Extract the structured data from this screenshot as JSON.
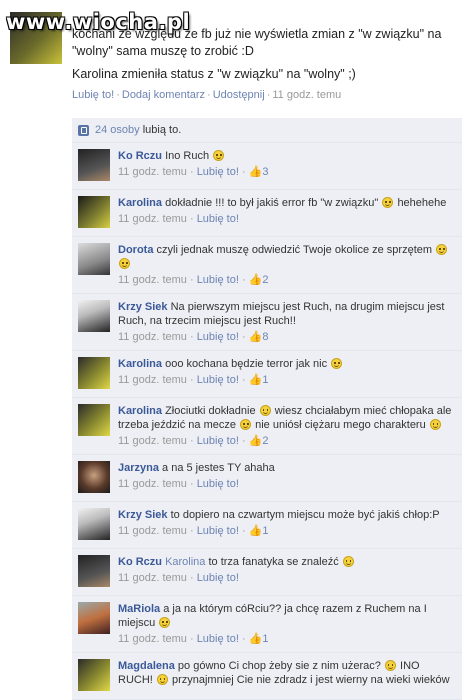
{
  "watermark": "www.wiocha.pl",
  "post": {
    "text_lines": [
      "kochani ze względu że fb już nie wyświetla zmian z \"w związku\" na",
      "\"wolny\" sama muszę to zrobić :D",
      "Karolina zmieniła status z \"w związku\" na \"wolny\" ;)"
    ],
    "actions": {
      "like": "Lubię to!",
      "comment": "Dodaj komentarz",
      "share": "Udostępnij",
      "time": "11 godz. temu"
    }
  },
  "likes_summary": {
    "count_link": "24 osoby",
    "text": "lubią to."
  },
  "comments": [
    {
      "author": "Ko Rczu",
      "text": "Ino Ruch",
      "time": "11 godz. temu",
      "like": "Lubię to!",
      "likes": "3"
    },
    {
      "author": "Karolina",
      "text": "dokładnie !!! to był jakiś error fb \"w związku\"",
      "text2": "hehehehe",
      "time": "11 godz. temu",
      "like": "Lubię to!",
      "likes": ""
    },
    {
      "author": "Dorota",
      "text": "czyli jednak muszę odwiedzić Twoje okolice ze sprzętem",
      "time": "11 godz. temu",
      "like": "Lubię to!",
      "likes": "2"
    },
    {
      "author": "Krzy Siek",
      "text": "Na pierwszym miejscu jest Ruch, na drugim miejscu jest Ruch, na trzecim miejscu jest Ruch!!",
      "time": "11 godz. temu",
      "like": "Lubię to!",
      "likes": "8"
    },
    {
      "author": "Karolina",
      "text": "ooo kochana będzie terror jak nic",
      "time": "11 godz. temu",
      "like": "Lubię to!",
      "likes": "1"
    },
    {
      "author": "Karolina",
      "text": "Złociutki dokładnie",
      "text2": "wiesz chciałabym mieć chłopaka ale trzeba jeździć na mecze",
      "text3": "nie uniósł ciężaru mego charakteru",
      "time": "11 godz. temu",
      "like": "Lubię to!",
      "likes": "2"
    },
    {
      "author": "Jarzyna",
      "text": "a na 5 jestes TY ahaha",
      "time": "11 godz. temu",
      "like": "Lubię to!",
      "likes": ""
    },
    {
      "author": "Krzy Siek",
      "text": "to dopiero na czwartym miejscu może być jakiś chłop:P",
      "time": "11 godz. temu",
      "like": "Lubię to!",
      "likes": "1"
    },
    {
      "author": "Ko Rczu",
      "mention": "Karolina",
      "text": "to trza fanatyka se znaleźć",
      "time": "11 godz. temu",
      "like": "Lubię to!",
      "likes": ""
    },
    {
      "author": "MaRiola",
      "text": "a ja na którym cóRciu?? ja chcę razem z Ruchem na I miejscu",
      "time": "11 godz. temu",
      "like": "Lubię to!",
      "likes": "1"
    },
    {
      "author": "Magdalena",
      "text": "po gówno Ci chop żeby sie z nim użerac?",
      "text2": "INO RUCH!",
      "text3": "przynajmniej Cie nie zdradz i jest wierny na wieki wieków",
      "time": "",
      "like": "",
      "likes": ""
    }
  ]
}
